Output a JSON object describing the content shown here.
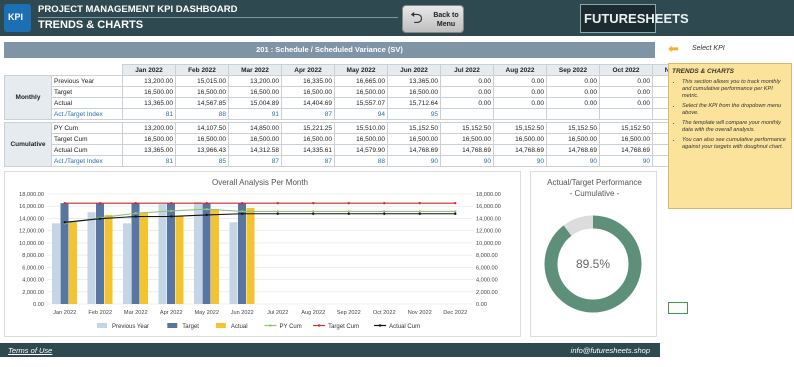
{
  "header": {
    "title": "PROJECT MANAGEMENT KPI DASHBOARD",
    "subtitle": "TRENDS & CHARTS",
    "logo_text": "KPI",
    "back_button_label": "Back to Menu",
    "brand": "FUTURESHEETS"
  },
  "kpi_bar": {
    "title": "201 : Schedule / Scheduled Variance (SV)"
  },
  "select_kpi": {
    "label": "Select KPI"
  },
  "table": {
    "months": [
      "Jan 2022",
      "Feb 2022",
      "Mar 2022",
      "Apr 2022",
      "May 2022",
      "Jun 2022",
      "Jul 2022",
      "Aug 2022",
      "Sep 2022",
      "Oct 2022",
      "Nov 2022",
      "Dec 2022"
    ],
    "monthly": {
      "group_label": "Monthly",
      "rows": [
        {
          "label": "Previous Year",
          "values": [
            "13,200.00",
            "15,015.00",
            "13,200.00",
            "16,335.00",
            "16,665.00",
            "13,365.00",
            "0.00",
            "0.00",
            "0.00",
            "0.00",
            "0.00",
            "0.00"
          ]
        },
        {
          "label": "Target",
          "values": [
            "16,500.00",
            "16,500.00",
            "16,500.00",
            "16,500.00",
            "16,500.00",
            "16,500.00",
            "0.00",
            "0.00",
            "0.00",
            "0.00",
            "0.00",
            "0.00"
          ]
        },
        {
          "label": "Actual",
          "values": [
            "13,365.00",
            "14,567.85",
            "15,004.89",
            "14,404.69",
            "15,557.07",
            "15,712.64",
            "0.00",
            "0.00",
            "0.00",
            "0.00",
            "0.00",
            "0.00"
          ]
        },
        {
          "label": "Act./Target Index",
          "values": [
            "81",
            "88",
            "91",
            "87",
            "94",
            "95",
            "",
            "",
            "",
            "",
            "",
            ""
          ]
        }
      ]
    },
    "cumulative": {
      "group_label": "Cumulative",
      "rows": [
        {
          "label": "PY Cum",
          "values": [
            "13,200.00",
            "14,107.50",
            "14,850.00",
            "15,221.25",
            "15,510.00",
            "15,152.50",
            "15,152.50",
            "15,152.50",
            "15,152.50",
            "15,152.50",
            "15,152.50",
            "15,152.50"
          ]
        },
        {
          "label": "Target Cum",
          "values": [
            "16,500.00",
            "16,500.00",
            "16,500.00",
            "16,500.00",
            "16,500.00",
            "16,500.00",
            "16,500.00",
            "16,500.00",
            "16,500.00",
            "16,500.00",
            "16,500.00",
            "16,500.00"
          ]
        },
        {
          "label": "Actual Cum",
          "values": [
            "13,365.00",
            "13,966.43",
            "14,312.58",
            "14,335.61",
            "14,579.90",
            "14,768.69",
            "14,768.69",
            "14,768.69",
            "14,768.69",
            "14,768.69",
            "14,768.69",
            "14,768.69"
          ]
        },
        {
          "label": "Act./Target Index",
          "values": [
            "81",
            "85",
            "87",
            "87",
            "88",
            "90",
            "90",
            "90",
            "90",
            "90",
            "90",
            "90"
          ]
        }
      ]
    }
  },
  "info": {
    "title": "TRENDS & CHARTS",
    "bullets": [
      "This section allows you to track monthly and cumulative performance per KPI metric.",
      "Select the KPI from the dropdown menu above.",
      "The template will compare your monthly data with the overall analysis.",
      "You can also see cumulative performance against your targets with doughnut chart."
    ]
  },
  "chart_data": [
    {
      "type": "bar",
      "title": "Overall Analysis Per Month",
      "categories": [
        "Jan 2022",
        "Feb 2022",
        "Mar 2022",
        "Apr 2022",
        "May 2022",
        "Jun 2022",
        "Jul 2022",
        "Aug 2022",
        "Sep 2022",
        "Oct 2022",
        "Nov 2022",
        "Dec 2022"
      ],
      "ylim": [
        0,
        18000
      ],
      "yticks": [
        "0.00",
        "2,000.00",
        "4,000.00",
        "6,000.00",
        "8,000.00",
        "10,000.00",
        "12,000.00",
        "14,000.00",
        "16,000.00",
        "18,000.00"
      ],
      "grid": true,
      "legend_position": "bottom",
      "series": [
        {
          "name": "Previous Year",
          "kind": "bar",
          "color": "#c5d5e6",
          "values": [
            13200,
            15015,
            13200,
            16335,
            16665,
            13365,
            0,
            0,
            0,
            0,
            0,
            0
          ]
        },
        {
          "name": "Target",
          "kind": "bar",
          "color": "#5876a0",
          "values": [
            16500,
            16500,
            16500,
            16500,
            16500,
            16500,
            0,
            0,
            0,
            0,
            0,
            0
          ]
        },
        {
          "name": "Actual",
          "kind": "bar",
          "color": "#f4c430",
          "values": [
            13365,
            14567.85,
            15004.89,
            14404.69,
            15557.07,
            15712.64,
            0,
            0,
            0,
            0,
            0,
            0
          ]
        },
        {
          "name": "PY Cum",
          "kind": "line",
          "color": "#8cc47a",
          "values": [
            13200,
            14107.5,
            14850,
            15221.25,
            15510,
            15152.5,
            15152.5,
            15152.5,
            15152.5,
            15152.5,
            15152.5,
            15152.5
          ]
        },
        {
          "name": "Target Cum",
          "kind": "line",
          "color": "#d12a2a",
          "values": [
            16500,
            16500,
            16500,
            16500,
            16500,
            16500,
            16500,
            16500,
            16500,
            16500,
            16500,
            16500
          ]
        },
        {
          "name": "Actual Cum",
          "kind": "line",
          "color": "#111111",
          "values": [
            13365,
            13966.43,
            14312.58,
            14335.61,
            14579.9,
            14768.69,
            14768.69,
            14768.69,
            14768.69,
            14768.69,
            14768.69,
            14768.69
          ]
        }
      ]
    },
    {
      "type": "pie",
      "title": "Actual/Target Performance",
      "subtitle": "- Cumulative -",
      "center_label": "89.5%",
      "values": [
        89.5,
        10.5
      ],
      "colors": [
        "#5e8f79",
        "#dcdcdc"
      ]
    }
  ],
  "footer": {
    "terms": "Terms of Use",
    "email": "info@futuresheets.shop"
  }
}
